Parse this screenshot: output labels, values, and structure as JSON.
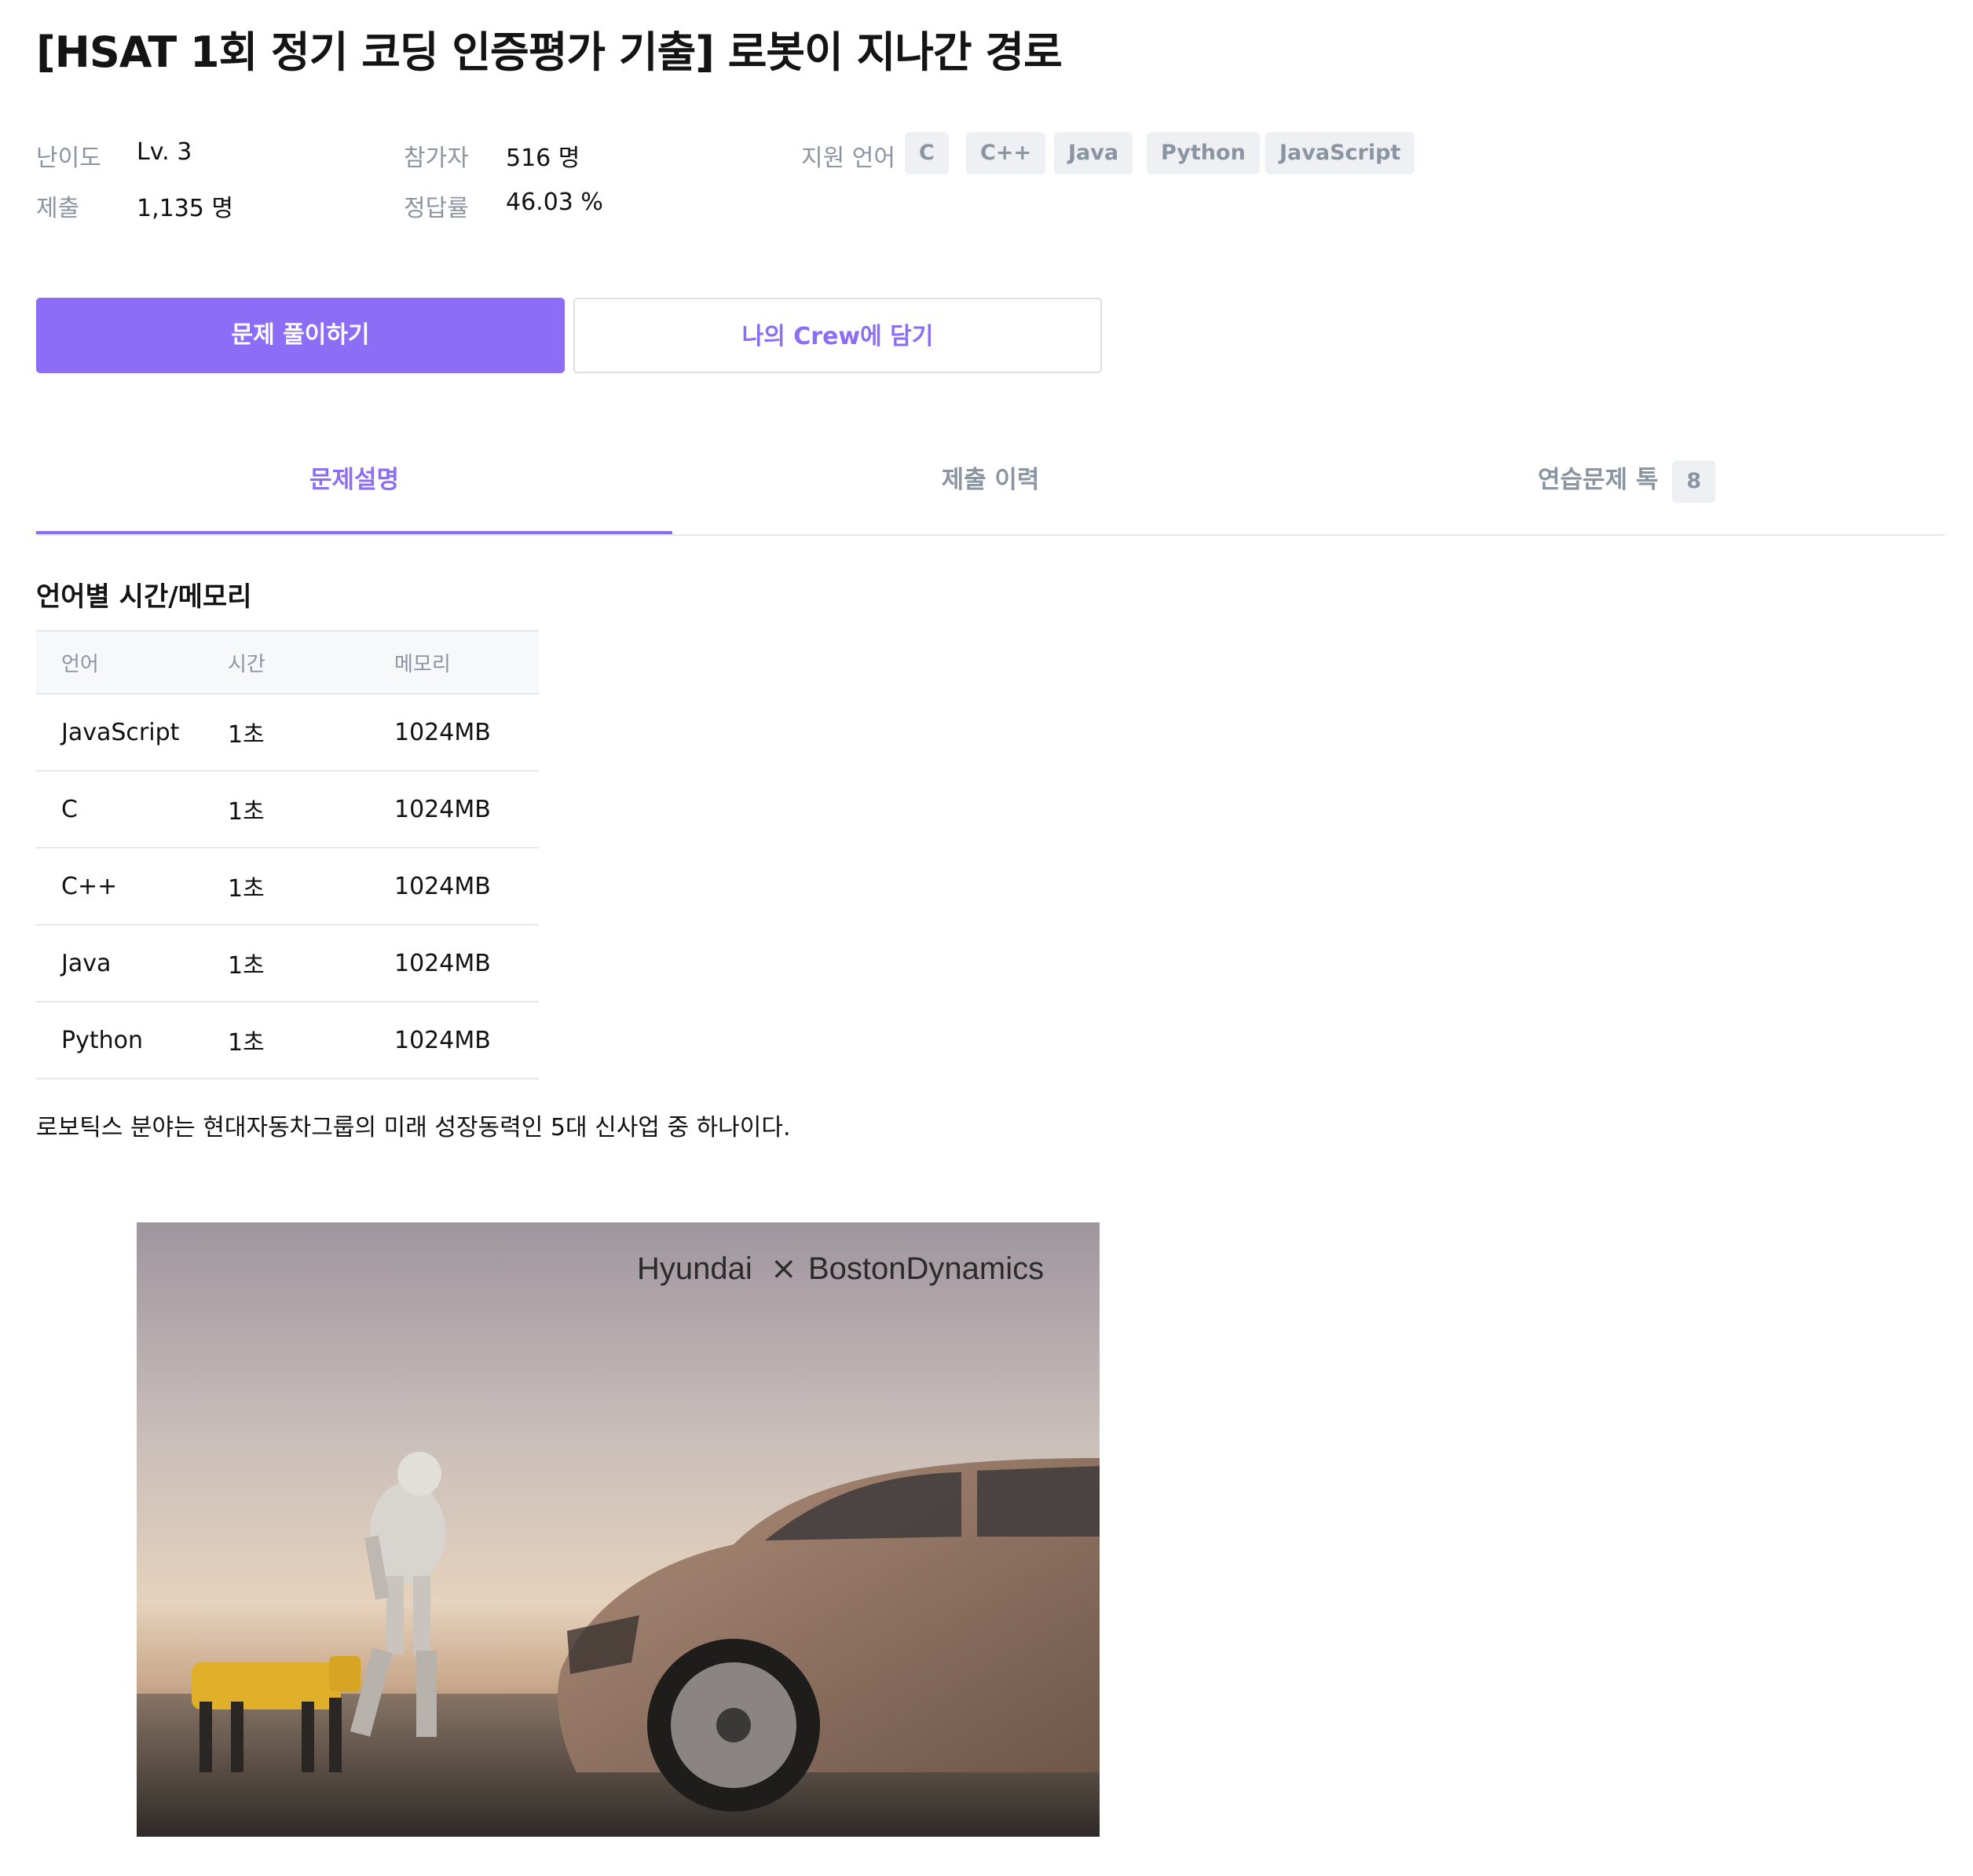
{
  "problem": {
    "title": "[HSAT 1회 정기 코딩 인증평가 기출] 로봇이 지나간 경로"
  },
  "meta": {
    "difficulty_label": "난이도",
    "difficulty_value": "Lv. 3",
    "participants_label": "참가자",
    "participants_value": "516 명",
    "languages_label": "지원 언어",
    "languages": [
      "C",
      "C++",
      "Java",
      "Python",
      "JavaScript"
    ],
    "submissions_label": "제출",
    "submissions_value": "1,135 명",
    "accuracy_label": "정답률",
    "accuracy_value": "46.03 %"
  },
  "actions": {
    "solve_label": "문제 풀이하기",
    "crew_label": "나의 Crew에 담기"
  },
  "tabs": {
    "description": "문제설명",
    "history": "제출 이력",
    "talk": "연습문제 톡",
    "talk_count": "8",
    "active": "description"
  },
  "limits": {
    "title": "언어별 시간/메모리",
    "headers": [
      "언어",
      "시간",
      "메모리"
    ],
    "rows": [
      [
        "JavaScript",
        "1초",
        "1024MB"
      ],
      [
        "C",
        "1초",
        "1024MB"
      ],
      [
        "C++",
        "1초",
        "1024MB"
      ],
      [
        "Java",
        "1초",
        "1024MB"
      ],
      [
        "Python",
        "1초",
        "1024MB"
      ]
    ]
  },
  "body": {
    "intro": "로보틱스 분야는 현대자동차그룹의 미래 성장동력인 5대 신사업 중 하나이다."
  },
  "hero_image": {
    "brand_left": "Hyundai",
    "brand_separator": "×",
    "brand_right": "BostonDynamics"
  },
  "colors": {
    "accent": "#8b6ef5",
    "muted": "#8b95a1",
    "chip_bg": "#eef0f3",
    "border": "#e5e8eb"
  }
}
